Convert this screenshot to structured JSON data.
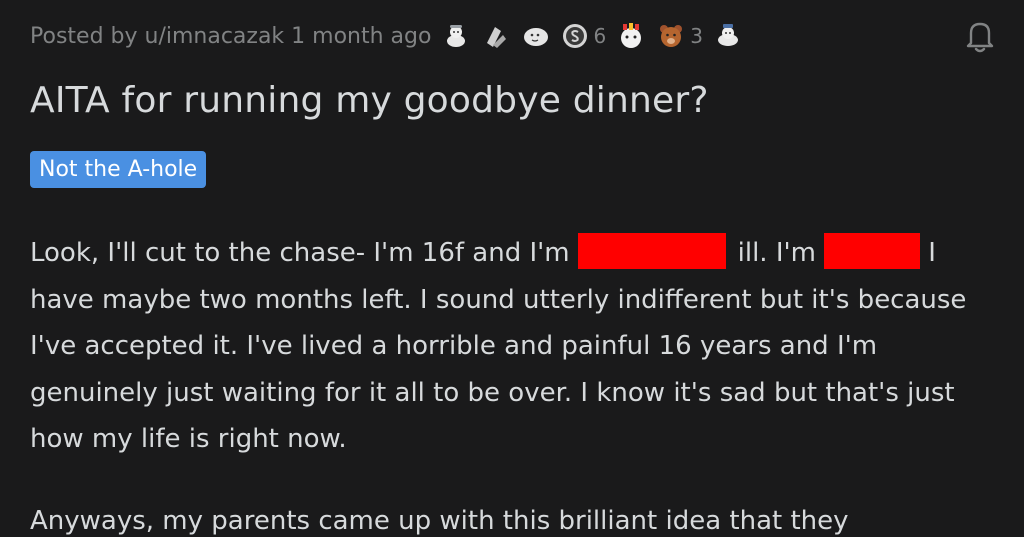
{
  "post": {
    "posted_by": "Posted by u/imnacazak 1 month ago",
    "awards": [
      {
        "icon": "wholesome-award-icon"
      },
      {
        "icon": "helpful-award-icon"
      },
      {
        "icon": "hugz-award-icon"
      },
      {
        "icon": "silver-award-icon",
        "count": "6"
      },
      {
        "icon": "take-my-energy-award-icon"
      },
      {
        "icon": "bear-award-icon",
        "count": "3"
      },
      {
        "icon": "wholesome-seal-icon"
      }
    ],
    "title": "AITA for running my goodbye dinner?",
    "flair": "Not the A-hole",
    "body": {
      "p1_part1": "Look, I'll cut to the chase- I'm 16f and I'm",
      "p1_part2": "ill. I'm",
      "p1_rest": "I have maybe two months left. I sound utterly indifferent but it's because I've accepted it. I've lived a horrible and painful 16 years and I'm genuinely just waiting for it all to be over. I know it's sad but that's just how my life is right now.",
      "p2": "Anyways, my parents came up with this brilliant idea that they"
    }
  },
  "colors": {
    "background": "#1a1a1b",
    "text": "#d7dadc",
    "meta": "#818384",
    "flair_bg": "#4a90e2",
    "redaction": "#ff0000"
  }
}
